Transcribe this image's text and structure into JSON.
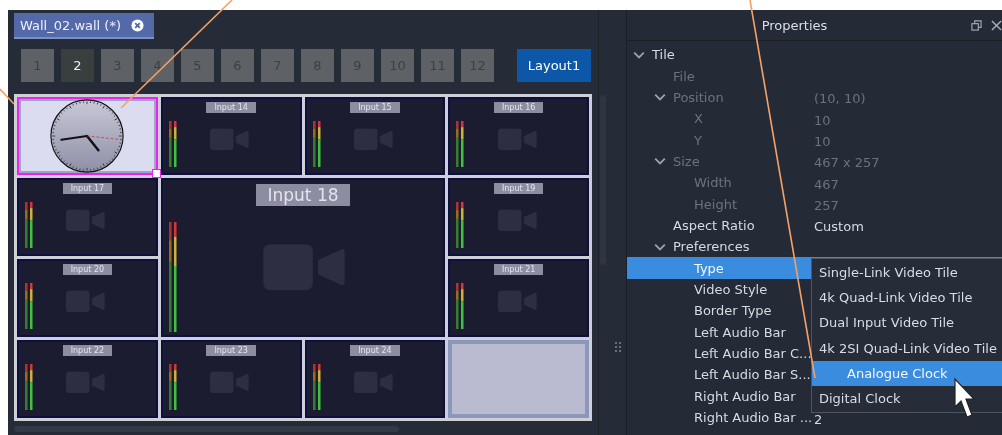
{
  "document_tab": {
    "title": "Wall_02.wall (*)"
  },
  "pages": [
    {
      "label": "1",
      "selected": false
    },
    {
      "label": "2",
      "selected": true
    },
    {
      "label": "3",
      "selected": false
    },
    {
      "label": "4",
      "selected": false
    },
    {
      "label": "5",
      "selected": false
    },
    {
      "label": "6",
      "selected": false
    },
    {
      "label": "7",
      "selected": false
    },
    {
      "label": "8",
      "selected": false
    },
    {
      "label": "9",
      "selected": false
    },
    {
      "label": "10",
      "selected": false
    },
    {
      "label": "11",
      "selected": false
    },
    {
      "label": "12",
      "selected": false
    }
  ],
  "layout_button": "Layout1",
  "tiles": [
    {
      "kind": "clock",
      "selected": true
    },
    {
      "kind": "video",
      "label": "Input 14",
      "selected": false
    },
    {
      "kind": "video",
      "label": "Input 15",
      "selected": false
    },
    {
      "kind": "video",
      "label": "Input 16",
      "selected": false
    },
    {
      "kind": "video",
      "label": "Input 17",
      "selected": false
    },
    {
      "kind": "large",
      "label": "Input 18",
      "selected": false
    },
    {
      "kind": "video",
      "label": "Input 19",
      "selected": false
    },
    {
      "kind": "video",
      "label": "Input 20",
      "selected": false
    },
    {
      "kind": "video",
      "label": "Input 21",
      "selected": false
    },
    {
      "kind": "video",
      "label": "Input 22",
      "selected": false
    },
    {
      "kind": "video",
      "label": "Input 23",
      "selected": false
    },
    {
      "kind": "video",
      "label": "Input 24",
      "selected": false
    },
    {
      "kind": "empty",
      "selected": false
    }
  ],
  "properties": {
    "title": "Properties",
    "tree": [
      {
        "label": "Tile",
        "expanded": true,
        "disabled": false,
        "selected": false,
        "children": [
          {
            "label": "File",
            "disabled": true,
            "selected": false
          },
          {
            "label": "Position",
            "value": "(10, 10)",
            "expanded": true,
            "disabled": true,
            "selected": false,
            "children": [
              {
                "label": "X",
                "value": "10",
                "disabled": true,
                "selected": false
              },
              {
                "label": "Y",
                "value": "10",
                "disabled": true,
                "selected": false
              }
            ]
          },
          {
            "label": "Size",
            "value": "467 x 257",
            "expanded": true,
            "disabled": true,
            "selected": false,
            "children": [
              {
                "label": "Width",
                "value": "467",
                "disabled": true,
                "selected": false
              },
              {
                "label": "Height",
                "value": "257",
                "disabled": true,
                "selected": false
              }
            ]
          },
          {
            "label": "Aspect Ratio",
            "value": "Custom",
            "disabled": false,
            "selected": false
          },
          {
            "label": "Preferences",
            "expanded": true,
            "disabled": false,
            "selected": false,
            "children": [
              {
                "label": "Type",
                "disabled": false,
                "selected": true
              },
              {
                "label": "Video Style",
                "disabled": false,
                "selected": false
              },
              {
                "label": "Border Type",
                "disabled": false,
                "selected": false
              },
              {
                "label": "Left Audio Bar",
                "disabled": false,
                "selected": false
              },
              {
                "label": "Left Audio Bar C...",
                "disabled": false,
                "selected": false
              },
              {
                "label": "Left Audio Bar S...",
                "disabled": false,
                "selected": false
              },
              {
                "label": "Right Audio Bar",
                "disabled": false,
                "selected": false
              },
              {
                "label": "Right Audio Bar ...",
                "value": "2",
                "disabled": false,
                "selected": false
              }
            ]
          }
        ]
      }
    ]
  },
  "type_dropdown": [
    {
      "label": "Single-Link Video Tile",
      "selected": false
    },
    {
      "label": "4k Quad-Link Video Tile",
      "selected": false
    },
    {
      "label": "Dual Input Video Tile",
      "selected": false
    },
    {
      "label": "4k 2SI Quad-Link Video Tile",
      "selected": false
    },
    {
      "label": "Analogue Clock",
      "selected": true
    },
    {
      "label": "Digital Clock",
      "selected": false
    }
  ]
}
